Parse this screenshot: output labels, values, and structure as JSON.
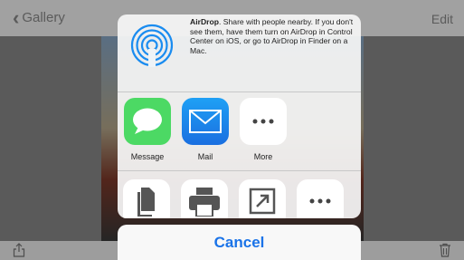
{
  "header": {
    "back_label": "Gallery",
    "edit_label": "Edit"
  },
  "airdrop": {
    "title": "AirDrop",
    "description": ". Share with people nearby. If you don't see them, have them turn on AirDrop in Control Center on iOS, or go to AirDrop in Finder on a Mac."
  },
  "share_apps": [
    {
      "label": "Message",
      "icon": "message-icon",
      "color": "#4cd964"
    },
    {
      "label": "Mail",
      "icon": "mail-icon",
      "color": "#1a8cf0"
    },
    {
      "label": "More",
      "icon": "more-icon",
      "color": "#ffffff"
    }
  ],
  "actions": [
    {
      "icon": "copy-icon"
    },
    {
      "icon": "print-icon"
    },
    {
      "icon": "open-in-icon"
    },
    {
      "icon": "more-icon"
    }
  ],
  "cancel_label": "Cancel",
  "colors": {
    "accent": "#1a73e8",
    "dim_overlay": "rgba(0,0,0,0.35)"
  }
}
